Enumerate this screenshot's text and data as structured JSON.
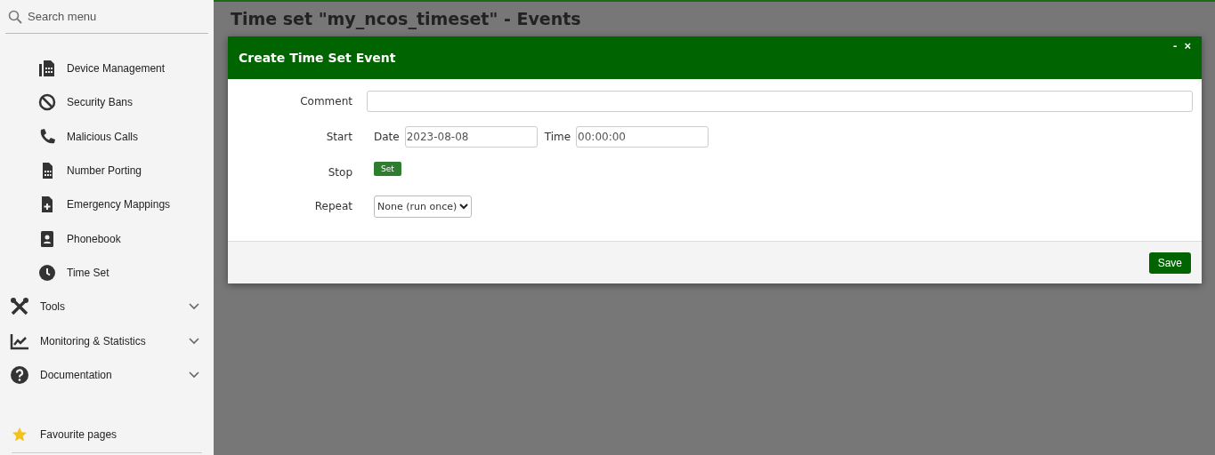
{
  "sidebar": {
    "search": {
      "placeholder": "Search menu"
    },
    "items": [
      {
        "label": "Device Management",
        "kind": "sub"
      },
      {
        "label": "Security Bans",
        "kind": "sub"
      },
      {
        "label": "Malicious Calls",
        "kind": "sub"
      },
      {
        "label": "Number Porting",
        "kind": "sub"
      },
      {
        "label": "Emergency Mappings",
        "kind": "sub"
      },
      {
        "label": "Phonebook",
        "kind": "sub"
      },
      {
        "label": "Time Set",
        "kind": "sub"
      },
      {
        "label": "Tools",
        "kind": "group",
        "expanded": false
      },
      {
        "label": "Monitoring & Statistics",
        "kind": "group",
        "expanded": false
      },
      {
        "label": "Documentation",
        "kind": "group",
        "expanded": false
      }
    ],
    "favourites": {
      "label": "Favourite pages"
    }
  },
  "page": {
    "title": "Time set \"my_ncos_timeset\" - Events"
  },
  "dialog": {
    "title": "Create Time Set Event",
    "minimize": "-",
    "close": "×",
    "comment": {
      "label": "Comment"
    },
    "start": {
      "label": "Start",
      "date_label": "Date",
      "date": "2023-08-08",
      "time_label": "Time",
      "time": "00:00:00"
    },
    "stop": {
      "label": "Stop",
      "button": "Set"
    },
    "repeat": {
      "label": "Repeat",
      "value": "None (run once)"
    },
    "save": "Save"
  }
}
